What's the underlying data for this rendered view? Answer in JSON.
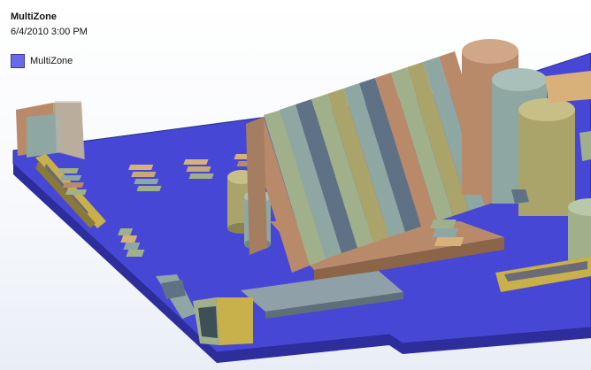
{
  "overlay": {
    "title": "MultiZone",
    "date": "6/4/2010 3:00 PM"
  },
  "legend": {
    "label": "MultiZone",
    "color": "#6a6ae8"
  },
  "colors": {
    "board": "#4747d6",
    "board_edge": "#2a2a8f",
    "copper": "#b88a6a",
    "olive": "#aaa36a",
    "teal_gray": "#8fa7a2",
    "slate": "#5f7185",
    "gold": "#c8b04a",
    "sage": "#9fb08a"
  }
}
